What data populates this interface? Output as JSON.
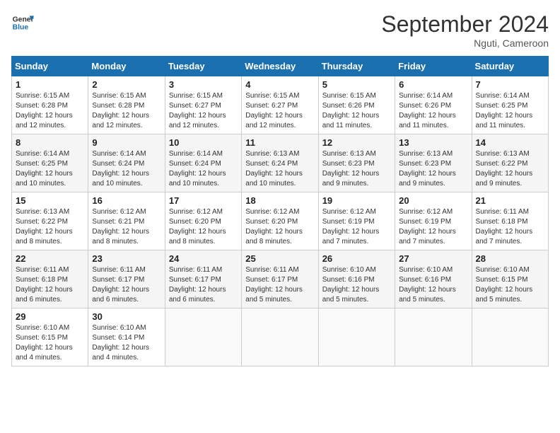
{
  "header": {
    "logo_line1": "General",
    "logo_line2": "Blue",
    "month_title": "September 2024",
    "location": "Nguti, Cameroon"
  },
  "columns": [
    "Sunday",
    "Monday",
    "Tuesday",
    "Wednesday",
    "Thursday",
    "Friday",
    "Saturday"
  ],
  "weeks": [
    [
      {
        "day": "1",
        "info": "Sunrise: 6:15 AM\nSunset: 6:28 PM\nDaylight: 12 hours\nand 12 minutes."
      },
      {
        "day": "2",
        "info": "Sunrise: 6:15 AM\nSunset: 6:28 PM\nDaylight: 12 hours\nand 12 minutes."
      },
      {
        "day": "3",
        "info": "Sunrise: 6:15 AM\nSunset: 6:27 PM\nDaylight: 12 hours\nand 12 minutes."
      },
      {
        "day": "4",
        "info": "Sunrise: 6:15 AM\nSunset: 6:27 PM\nDaylight: 12 hours\nand 12 minutes."
      },
      {
        "day": "5",
        "info": "Sunrise: 6:15 AM\nSunset: 6:26 PM\nDaylight: 12 hours\nand 11 minutes."
      },
      {
        "day": "6",
        "info": "Sunrise: 6:14 AM\nSunset: 6:26 PM\nDaylight: 12 hours\nand 11 minutes."
      },
      {
        "day": "7",
        "info": "Sunrise: 6:14 AM\nSunset: 6:25 PM\nDaylight: 12 hours\nand 11 minutes."
      }
    ],
    [
      {
        "day": "8",
        "info": "Sunrise: 6:14 AM\nSunset: 6:25 PM\nDaylight: 12 hours\nand 10 minutes."
      },
      {
        "day": "9",
        "info": "Sunrise: 6:14 AM\nSunset: 6:24 PM\nDaylight: 12 hours\nand 10 minutes."
      },
      {
        "day": "10",
        "info": "Sunrise: 6:14 AM\nSunset: 6:24 PM\nDaylight: 12 hours\nand 10 minutes."
      },
      {
        "day": "11",
        "info": "Sunrise: 6:13 AM\nSunset: 6:24 PM\nDaylight: 12 hours\nand 10 minutes."
      },
      {
        "day": "12",
        "info": "Sunrise: 6:13 AM\nSunset: 6:23 PM\nDaylight: 12 hours\nand 9 minutes."
      },
      {
        "day": "13",
        "info": "Sunrise: 6:13 AM\nSunset: 6:23 PM\nDaylight: 12 hours\nand 9 minutes."
      },
      {
        "day": "14",
        "info": "Sunrise: 6:13 AM\nSunset: 6:22 PM\nDaylight: 12 hours\nand 9 minutes."
      }
    ],
    [
      {
        "day": "15",
        "info": "Sunrise: 6:13 AM\nSunset: 6:22 PM\nDaylight: 12 hours\nand 8 minutes."
      },
      {
        "day": "16",
        "info": "Sunrise: 6:12 AM\nSunset: 6:21 PM\nDaylight: 12 hours\nand 8 minutes."
      },
      {
        "day": "17",
        "info": "Sunrise: 6:12 AM\nSunset: 6:20 PM\nDaylight: 12 hours\nand 8 minutes."
      },
      {
        "day": "18",
        "info": "Sunrise: 6:12 AM\nSunset: 6:20 PM\nDaylight: 12 hours\nand 8 minutes."
      },
      {
        "day": "19",
        "info": "Sunrise: 6:12 AM\nSunset: 6:19 PM\nDaylight: 12 hours\nand 7 minutes."
      },
      {
        "day": "20",
        "info": "Sunrise: 6:12 AM\nSunset: 6:19 PM\nDaylight: 12 hours\nand 7 minutes."
      },
      {
        "day": "21",
        "info": "Sunrise: 6:11 AM\nSunset: 6:18 PM\nDaylight: 12 hours\nand 7 minutes."
      }
    ],
    [
      {
        "day": "22",
        "info": "Sunrise: 6:11 AM\nSunset: 6:18 PM\nDaylight: 12 hours\nand 6 minutes."
      },
      {
        "day": "23",
        "info": "Sunrise: 6:11 AM\nSunset: 6:17 PM\nDaylight: 12 hours\nand 6 minutes."
      },
      {
        "day": "24",
        "info": "Sunrise: 6:11 AM\nSunset: 6:17 PM\nDaylight: 12 hours\nand 6 minutes."
      },
      {
        "day": "25",
        "info": "Sunrise: 6:11 AM\nSunset: 6:17 PM\nDaylight: 12 hours\nand 5 minutes."
      },
      {
        "day": "26",
        "info": "Sunrise: 6:10 AM\nSunset: 6:16 PM\nDaylight: 12 hours\nand 5 minutes."
      },
      {
        "day": "27",
        "info": "Sunrise: 6:10 AM\nSunset: 6:16 PM\nDaylight: 12 hours\nand 5 minutes."
      },
      {
        "day": "28",
        "info": "Sunrise: 6:10 AM\nSunset: 6:15 PM\nDaylight: 12 hours\nand 5 minutes."
      }
    ],
    [
      {
        "day": "29",
        "info": "Sunrise: 6:10 AM\nSunset: 6:15 PM\nDaylight: 12 hours\nand 4 minutes."
      },
      {
        "day": "30",
        "info": "Sunrise: 6:10 AM\nSunset: 6:14 PM\nDaylight: 12 hours\nand 4 minutes."
      },
      {
        "day": "",
        "info": ""
      },
      {
        "day": "",
        "info": ""
      },
      {
        "day": "",
        "info": ""
      },
      {
        "day": "",
        "info": ""
      },
      {
        "day": "",
        "info": ""
      }
    ]
  ]
}
